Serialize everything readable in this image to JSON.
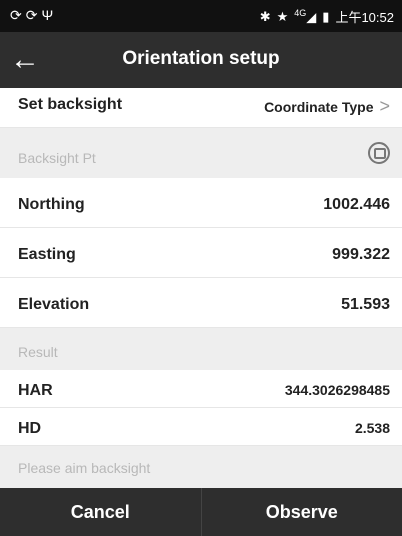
{
  "status_bar": {
    "left_icons": [
      "sync-icon",
      "sync-icon",
      "usb-icon"
    ],
    "right_icons": [
      "bluetooth-icon",
      "star-icon",
      "signal-icon",
      "battery-icon"
    ],
    "network": "4G",
    "time": "上午10:52"
  },
  "header": {
    "title": "Orientation setup",
    "back_icon": "←"
  },
  "set_backsight": {
    "label": "Set backsight",
    "value": "Coordinate Type"
  },
  "backsight_section": {
    "label": "Backsight Pt"
  },
  "northing": {
    "label": "Northing",
    "value": "1002.446"
  },
  "easting": {
    "label": "Easting",
    "value": "999.322"
  },
  "elevation": {
    "label": "Elevation",
    "value": "51.593"
  },
  "result_section": {
    "label": "Result"
  },
  "har": {
    "label": "HAR",
    "value": "344.3026298485"
  },
  "hd": {
    "label": "HD",
    "value": "2.538"
  },
  "hint": "Please aim backsight",
  "footer": {
    "cancel": "Cancel",
    "observe": "Observe"
  }
}
